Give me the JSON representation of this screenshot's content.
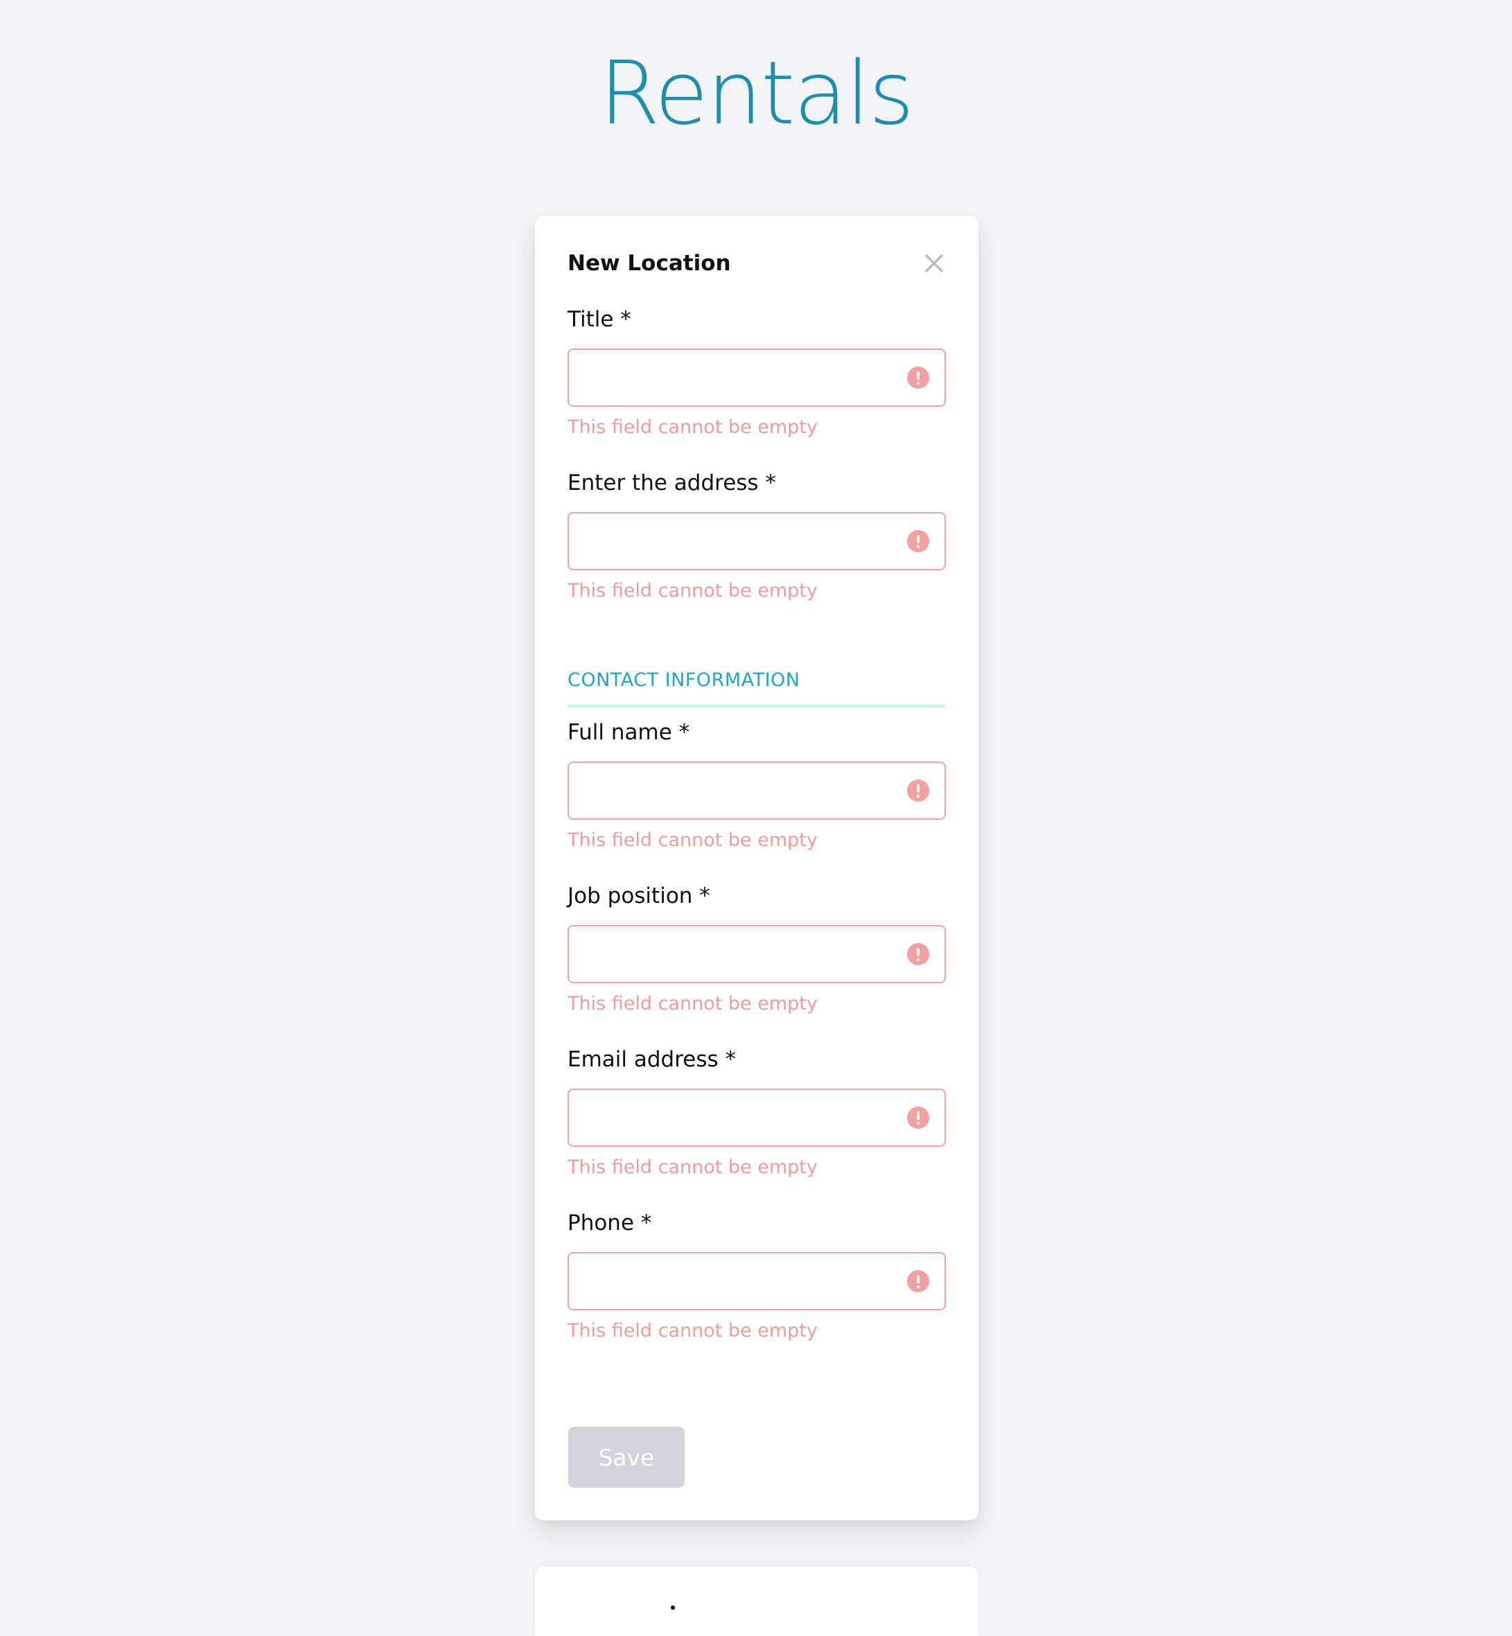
{
  "app": {
    "title": "Rentals",
    "accent_color": "#1a8fb0"
  },
  "modal": {
    "title": "New Location",
    "close_icon": "close-icon",
    "section_heading": "CONTACT INFORMATION",
    "save_label": "Save",
    "error_color": "#f29b9b",
    "fields": [
      {
        "label": "Title *",
        "value": "",
        "error": "This field cannot be empty",
        "icon": "alert-circle-icon"
      },
      {
        "label": "Enter the address *",
        "value": "",
        "error": "This field cannot be empty",
        "icon": "alert-circle-icon"
      },
      {
        "label": "Full name *",
        "value": "",
        "error": "This field cannot be empty",
        "icon": "alert-circle-icon"
      },
      {
        "label": "Job position *",
        "value": "",
        "error": "This field cannot be empty",
        "icon": "alert-circle-icon"
      },
      {
        "label": "Email address *",
        "value": "",
        "error": "This field cannot be empty",
        "icon": "alert-circle-icon"
      },
      {
        "label": "Phone *",
        "value": "",
        "error": "This field cannot be empty",
        "icon": "alert-circle-icon"
      }
    ]
  }
}
